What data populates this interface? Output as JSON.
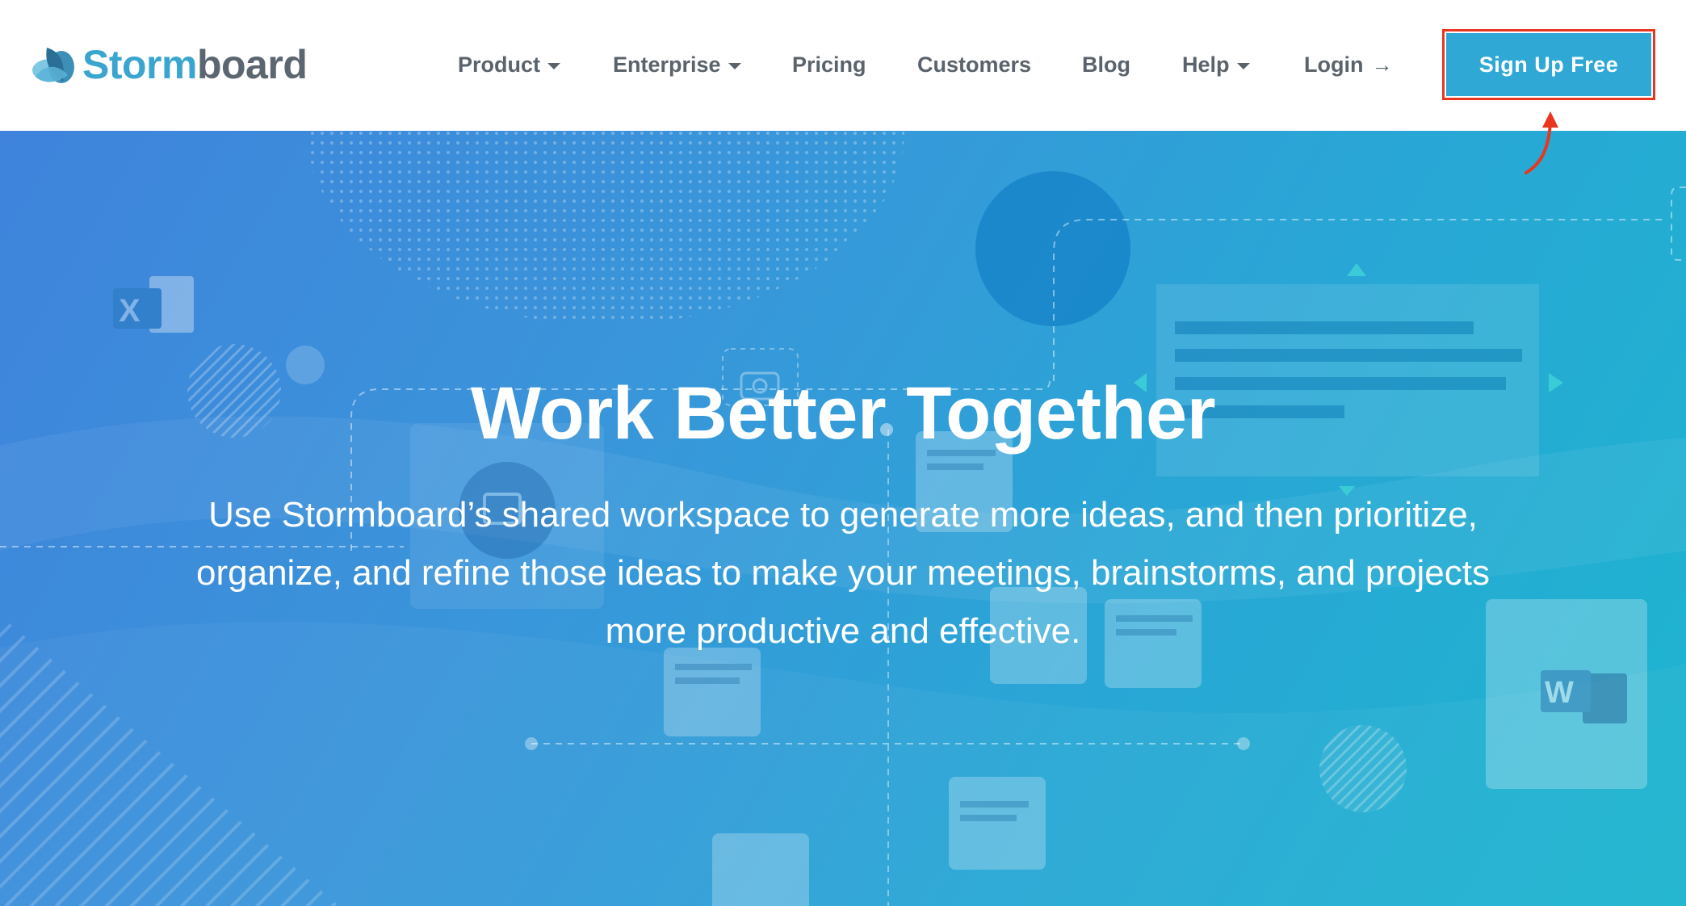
{
  "header": {
    "logo": {
      "part1": "Storm",
      "part2": "board"
    },
    "nav": [
      {
        "label": "Product",
        "has_dropdown": true
      },
      {
        "label": "Enterprise",
        "has_dropdown": true
      },
      {
        "label": "Pricing",
        "has_dropdown": false
      },
      {
        "label": "Customers",
        "has_dropdown": false
      },
      {
        "label": "Blog",
        "has_dropdown": false
      },
      {
        "label": "Help",
        "has_dropdown": true
      }
    ],
    "login": {
      "label": "Login",
      "icon": "arrow-right-icon"
    },
    "signup": {
      "label": "Sign Up Free",
      "highlight_color": "#e8361f",
      "bg_color": "#2fa8d6"
    }
  },
  "hero": {
    "title": "Work Better Together",
    "subtitle_lines": [
      "Use Stormboard’s shared workspace to generate more ideas, and then prioritize,",
      "organize, and refine those ideas to make your meetings, brainstorms, and projects",
      "more productive and effective."
    ],
    "decor_icons": [
      "excel-icon",
      "word-icon",
      "camera-icon",
      "video-icon"
    ]
  },
  "colors": {
    "brand_blue": "#3aa6cf",
    "brand_gray": "#5b6670",
    "nav_text": "#5a636b",
    "hero_start": "#3f83dc",
    "hero_end": "#1db5cf"
  }
}
